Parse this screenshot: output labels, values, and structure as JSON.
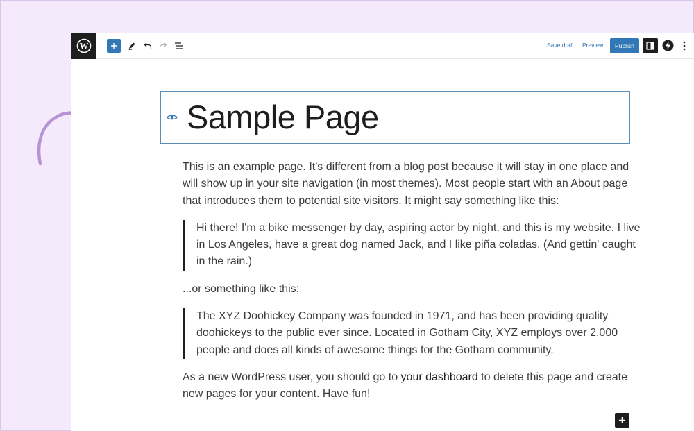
{
  "toolbar": {
    "save_draft": "Save draft",
    "preview": "Preview",
    "publish": "Publish"
  },
  "editor": {
    "title": "Sample Page",
    "paragraph1": "This is an example page. It's different from a blog post because it will stay in one place and will show up in your site navigation (in most themes). Most people start with an About page that introduces them to potential site visitors. It might say something like this:",
    "quote1": "Hi there! I'm a bike messenger by day, aspiring actor by night, and this is my website. I live in Los Angeles, have a great dog named Jack, and I like piña coladas. (And gettin' caught in the rain.)",
    "paragraph2": "...or something like this:",
    "quote2": "The XYZ Doohickey Company was founded in 1971, and has been providing quality doohickeys to the public ever since. Located in Gotham City, XYZ employs over 2,000 people and does all kinds of awesome things for the Gotham community.",
    "paragraph3_before": "As a new WordPress user, you should go to ",
    "paragraph3_link": "your dashboard",
    "paragraph3_after": " to delete this page and create new pages for your content. Have fun!"
  },
  "colors": {
    "accent": "#3278b6",
    "background": "#f5eafc",
    "arrow": "#b794d6",
    "dark": "#1e1e1e"
  },
  "icons": [
    "wordpress-logo-icon",
    "plus-icon",
    "pen-icon",
    "undo-icon",
    "redo-icon",
    "list-view-icon",
    "settings-sidebar-icon",
    "jetpack-icon",
    "more-options-icon",
    "eye-icon",
    "curved-arrow-icon"
  ]
}
